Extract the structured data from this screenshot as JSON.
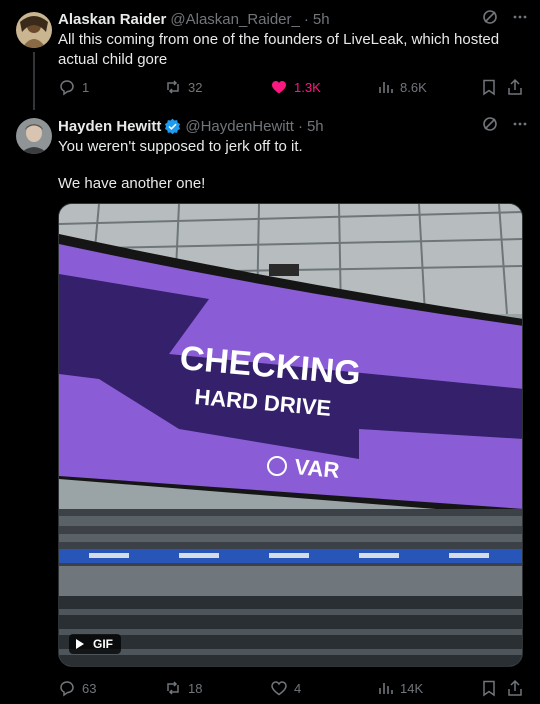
{
  "tweets": [
    {
      "name": "Alaskan Raider",
      "handle": "@Alaskan_Raider_",
      "time": "5h",
      "dot": "·",
      "text": "All this coming from one of the founders of LiveLeak, which hosted actual child gore",
      "stats": {
        "replies": "1",
        "reposts": "32",
        "likes": "1.3K",
        "views": "8.6K"
      },
      "liked": true
    },
    {
      "name": "Hayden Hewitt",
      "handle": "@HaydenHewitt",
      "time": "5h",
      "dot": "·",
      "verified": true,
      "text_line1": "You weren't supposed to jerk off to it.",
      "text_line2": "We have another one!",
      "media": {
        "type": "gif",
        "badge": "GIF",
        "screen_line1": "CHECKING",
        "screen_line2": "HARD DRIVE",
        "screen_logo": "VAR"
      },
      "stats": {
        "replies": "63",
        "reposts": "18",
        "likes": "4",
        "views": "14K"
      }
    }
  ],
  "colors": {
    "background": "#000000",
    "text": "#e7e9ea",
    "muted": "#71767b",
    "like_active": "#f91880",
    "verified": "#1d9bf0",
    "screen_purple": "#8a5cd6",
    "screen_dark": "#35206b"
  }
}
